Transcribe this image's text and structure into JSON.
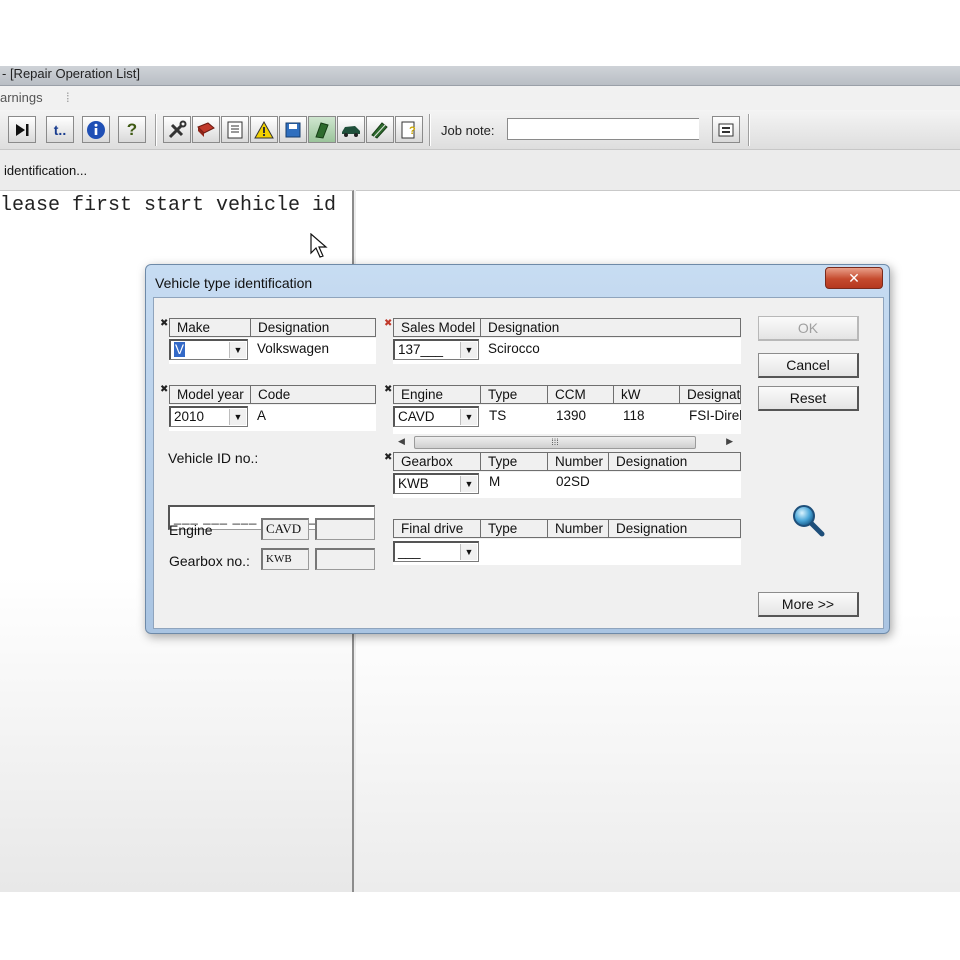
{
  "app": {
    "title": "- [Repair Operation List]",
    "menu_item": "arnings",
    "job_note_label": "Job note:",
    "job_note_value": "",
    "identification_text": "identification...",
    "message": "lease first start vehicle id"
  },
  "toolbar": {
    "icons": [
      "play-end-icon",
      "t-icon",
      "info-icon",
      "help-icon",
      "tools-icon",
      "book-icon",
      "document-icon",
      "warning-icon",
      "save-icon",
      "hand-icon",
      "car-icon",
      "pencil-icon",
      "notepad-icon",
      "jobnote-icon"
    ]
  },
  "dialog": {
    "title": "Vehicle type identification",
    "close": "✕",
    "make": {
      "header": "Make",
      "designation_header": "Designation",
      "value": "V",
      "designation": "Volkswagen"
    },
    "sales_model": {
      "header": "Sales Model",
      "designation_header": "Designation",
      "value": "137___",
      "designation": "Scirocco"
    },
    "model_year": {
      "header": "Model year",
      "code_header": "Code",
      "value": "2010",
      "code": "A"
    },
    "engine": {
      "header": "Engine",
      "type_header": "Type",
      "ccm_header": "CCM",
      "kw_header": "kW",
      "designation_header": "Designat",
      "value": "CAVD",
      "type": "TS",
      "ccm": "1390",
      "kw": "118",
      "designation": "FSI-Direk"
    },
    "gearbox": {
      "header": "Gearbox",
      "type_header": "Type",
      "number_header": "Number",
      "designation_header": "Designation",
      "value": "KWB",
      "type": "M",
      "number": "02SD",
      "designation": ""
    },
    "final_drive": {
      "header": "Final drive",
      "type_header": "Type",
      "number_header": "Number",
      "designation_header": "Designation",
      "value": "___"
    },
    "vehicle_id_label": "Vehicle ID no.:",
    "vehicle_id_value": "___ ___ ___ _ _ _ _____",
    "engine_label": "Engine",
    "engine_code": "CAVD",
    "gearbox_label": "Gearbox no.:",
    "gearbox_code": "KWB",
    "buttons": {
      "ok": "OK",
      "cancel": "Cancel",
      "reset": "Reset",
      "more": "More >>"
    }
  }
}
